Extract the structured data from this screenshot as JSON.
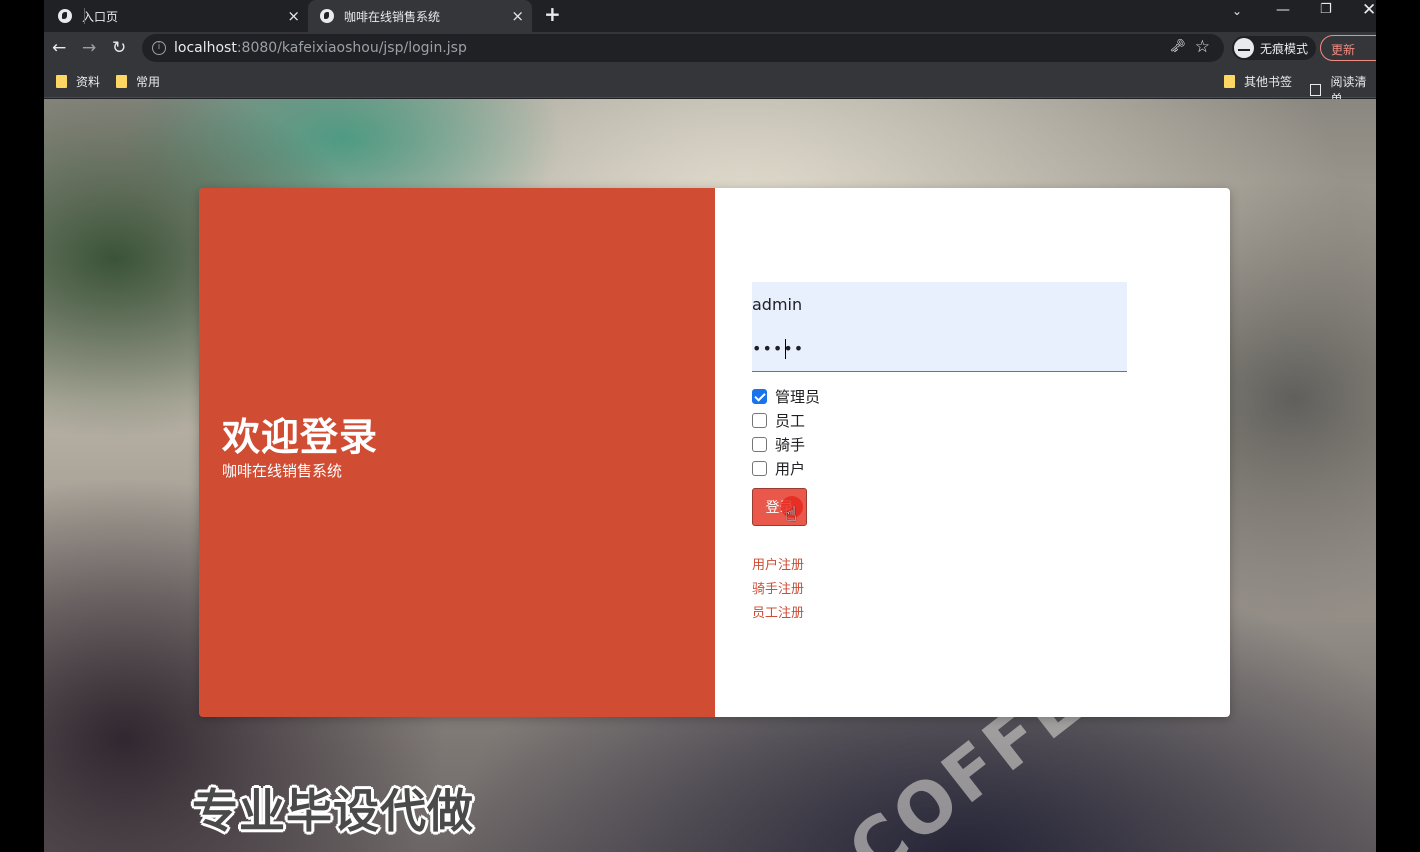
{
  "browser": {
    "tabs": [
      {
        "label": "入口页"
      },
      {
        "label": "咖啡在线销售系统"
      }
    ],
    "tab_close_glyph": "×",
    "new_tab_glyph": "+",
    "url_host": "localhost",
    "url_rest": ":8080/kafeixiaoshou/jsp/login.jsp",
    "incognito_label": "无痕模式",
    "update_label": "更新",
    "bookmarks": [
      {
        "label": "资料"
      },
      {
        "label": "常用"
      },
      {
        "label": "其他书签"
      },
      {
        "label": "阅读清单"
      }
    ]
  },
  "login": {
    "welcome_title": "欢迎登录",
    "subtitle": "咖啡在线销售系统",
    "username_value": "admin",
    "password_value": "•••••",
    "roles": [
      {
        "label": "管理员",
        "checked": true
      },
      {
        "label": "员工",
        "checked": false
      },
      {
        "label": "骑手",
        "checked": false
      },
      {
        "label": "用户",
        "checked": false
      }
    ],
    "login_button": "登录",
    "links": [
      {
        "label": "用户注册"
      },
      {
        "label": "骑手注册"
      },
      {
        "label": "员工注册"
      }
    ]
  },
  "background_text": "COFFEE",
  "watermark": "专业毕设代做",
  "colors": {
    "primary": "#d04c33",
    "button": "#e9584a",
    "input_bg": "#e8f0fe",
    "checkbox": "#1a73e8"
  }
}
